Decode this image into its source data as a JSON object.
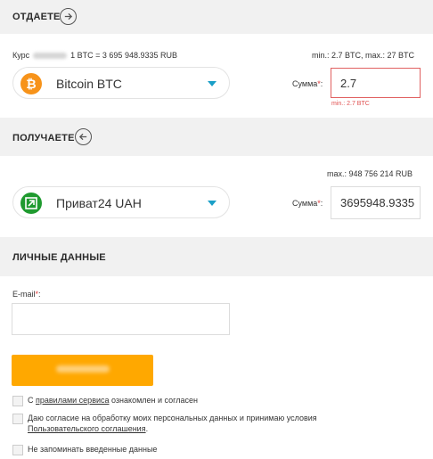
{
  "give": {
    "title": "ОТДАЕТЕ",
    "arrow_icon": "arrow-right-circle-icon",
    "rate_prefix": "Курс",
    "rate_value": "1 BTC = 3 695 948.9335 RUB",
    "limits": "min.: 2.7 BTC, max.: 27 BTC",
    "currency": "Bitcoin BTC",
    "currency_icon": "bitcoin-icon",
    "sum_label": "Сумма",
    "sum_required": "*",
    "sum_colon": ":",
    "sum_value": "2.7",
    "sum_error": "min.: 2.7 BTC"
  },
  "receive": {
    "title": "ПОЛУЧАЕТЕ",
    "arrow_icon": "arrow-left-circle-icon",
    "limits": "max.: 948 756 214 RUB",
    "currency": "Приват24 UAH",
    "currency_icon": "privat24-icon",
    "sum_label": "Сумма",
    "sum_required": "*",
    "sum_colon": ":",
    "sum_value": "3695948.9335"
  },
  "personal": {
    "title": "ЛИЧНЫЕ ДАННЫЕ",
    "email_label": "E-mail",
    "email_required": "*",
    "email_colon": ":",
    "email_value": ""
  },
  "agreements": {
    "rules_prefix": "С",
    "rules_link": "правилами сервиса",
    "rules_suffix": "ознакомлен и согласен",
    "consent_text": "Даю согласие на обработку моих персональных данных и принимаю условия",
    "consent_link": "Пользовательского соглашения",
    "consent_dot": ".",
    "remember_text": "Не запоминать введенные данные"
  },
  "colors": {
    "accent": "#ffa800",
    "bitcoin": "#f7931a",
    "privat": "#1f9a2f",
    "caret": "#1a9fc7",
    "error": "#e05050"
  }
}
